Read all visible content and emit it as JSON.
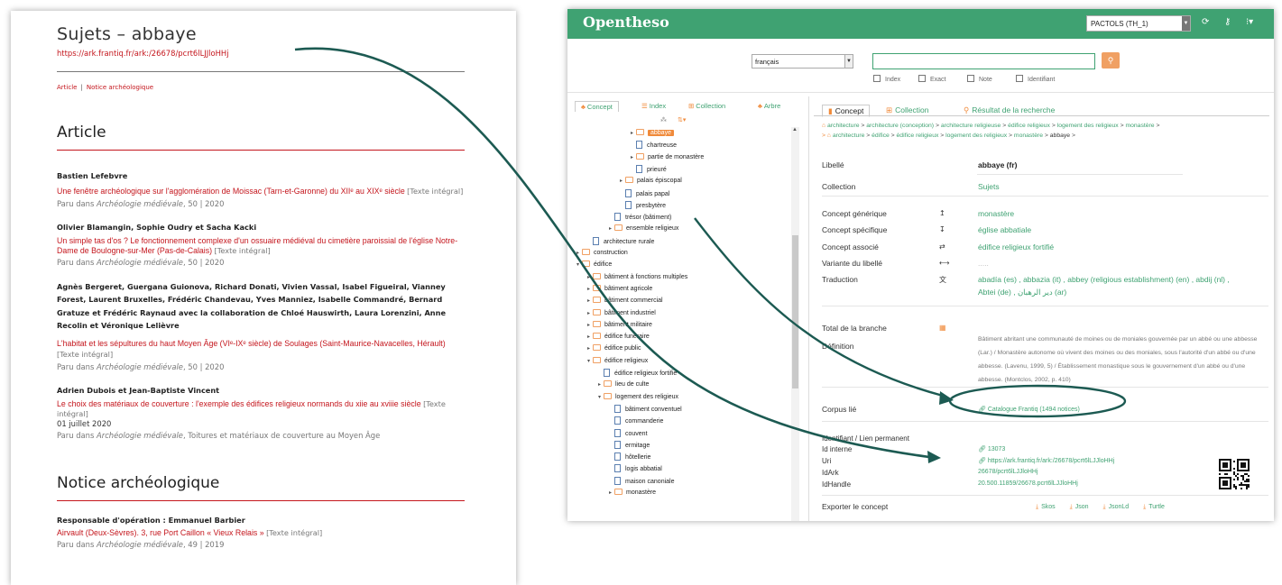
{
  "document": {
    "title": "Sujets – abbaye",
    "url": "https://ark.frantiq.fr/ark:/26678/pcrt6lLJJloHHj",
    "nav": [
      "Article",
      "Notice archéologique"
    ],
    "nav_separator": "|",
    "sections": [
      {
        "heading": "Article",
        "entries": [
          {
            "authors": "Bastien Lefebvre",
            "title": "Une fenêtre archéologique sur l'agglomération de Moissac (Tarn-et-Garonne) du XIIᵉ au XIXᵉ siècle",
            "link_label": "[Texte intégral]",
            "date": "",
            "published_prefix": "Paru dans ",
            "journal": "Archéologie médiévale",
            "published_suffix": ", 50 | 2020"
          },
          {
            "authors": "Olivier Blamangin, Sophie Oudry et Sacha Kacki",
            "title": "Un simple tas d'os ? Le fonctionnement complexe d'un ossuaire médiéval du cimetière paroissial de l'église Notre-Dame de Boulogne-sur-Mer (Pas-de-Calais)",
            "link_label": "[Texte intégral]",
            "date": "",
            "published_prefix": "Paru dans ",
            "journal": "Archéologie médiévale",
            "published_suffix": ", 50 | 2020"
          },
          {
            "authors": "Agnès Bergeret, Guergana Guionova, Richard Donati, Vivien Vassal, Isabel Figueiral, Vianney Forest, Laurent Bruxelles, Frédéric Chandevau, Yves Manniez, Isabelle Commandré, Bernard Gratuze et Frédéric Raynaud avec la collaboration de Chloé Hauswirth, Laura Lorenzini, Anne Recolin et Véronique Lelièvre",
            "title": "L'habitat et les sépultures du haut Moyen Âge (VIᵉ-IXᵉ siècle) de Soulages (Saint-Maurice-Navacelles, Hérault)",
            "link_label": "[Texte intégral]",
            "date": "",
            "published_prefix": "Paru dans ",
            "journal": "Archéologie médiévale",
            "published_suffix": ", 50 | 2020"
          },
          {
            "authors": "Adrien Dubois et Jean-Baptiste Vincent",
            "title": "Le choix des matériaux de couverture : l'exemple des édifices religieux normands du xiie au xviiie siècle",
            "link_label": "[Texte intégral]",
            "date": "01 juillet 2020",
            "published_prefix": "Paru dans ",
            "journal": "Archéologie médiévale",
            "published_suffix": ", Toitures et matériaux de couverture au Moyen Âge"
          }
        ]
      },
      {
        "heading": "Notice archéologique",
        "entries": [
          {
            "authors": "Responsable d'opération : Emmanuel Barbier",
            "title": "Airvault (Deux-Sèvres). 3, rue Port Caillon « Vieux Relais »",
            "link_label": "[Texte intégral]",
            "date": "",
            "published_prefix": "Paru dans ",
            "journal": "Archéologie médiévale",
            "published_suffix": ", 49 | 2019"
          }
        ]
      }
    ]
  },
  "opentheso": {
    "app_name": "Opentheso",
    "thesaurus_select": "PACTOLS (TH_1)",
    "search": {
      "language": "français",
      "query": "",
      "options": [
        "Index",
        "Exact",
        "Note",
        "Identifiant"
      ]
    },
    "left_tabs": [
      "Concept",
      "Index",
      "Collection",
      "Arbre"
    ],
    "tree": [
      {
        "label": "abbaye",
        "type": "folder",
        "level": 5,
        "selected": true
      },
      {
        "label": "chartreuse",
        "type": "leaf",
        "level": 5
      },
      {
        "label": "partie de monastère",
        "type": "folder",
        "level": 5
      },
      {
        "label": "prieuré",
        "type": "leaf",
        "level": 5
      },
      {
        "label": "palais épiscopal",
        "type": "folder",
        "level": 4
      },
      {
        "label": "palais papal",
        "type": "leaf",
        "level": 4
      },
      {
        "label": "presbytère",
        "type": "leaf",
        "level": 4
      },
      {
        "label": "trésor (bâtiment)",
        "type": "leaf",
        "level": 3
      },
      {
        "label": "ensemble religieux",
        "type": "folder",
        "level": 3
      },
      {
        "label": "architecture rurale",
        "type": "leaf",
        "level": 1
      },
      {
        "label": "construction",
        "type": "folder",
        "level": 0
      },
      {
        "label": "édifice",
        "type": "folder",
        "level": 0,
        "open": true
      },
      {
        "label": "bâtiment à fonctions multiples",
        "type": "folder",
        "level": 1
      },
      {
        "label": "bâtiment agricole",
        "type": "folder",
        "level": 1
      },
      {
        "label": "bâtiment commercial",
        "type": "folder",
        "level": 1
      },
      {
        "label": "bâtiment industriel",
        "type": "folder",
        "level": 1
      },
      {
        "label": "bâtiment militaire",
        "type": "folder",
        "level": 1
      },
      {
        "label": "édifice funéraire",
        "type": "folder",
        "level": 1
      },
      {
        "label": "édifice public",
        "type": "folder",
        "level": 1
      },
      {
        "label": "édifice religieux",
        "type": "folder",
        "level": 1,
        "open": true
      },
      {
        "label": "édifice religieux fortifié",
        "type": "leaf",
        "level": 2
      },
      {
        "label": "lieu de culte",
        "type": "folder",
        "level": 2
      },
      {
        "label": "logement des religieux",
        "type": "folder",
        "level": 2,
        "open": true
      },
      {
        "label": "bâtiment conventuel",
        "type": "leaf",
        "level": 3
      },
      {
        "label": "commanderie",
        "type": "leaf",
        "level": 3
      },
      {
        "label": "couvent",
        "type": "leaf",
        "level": 3
      },
      {
        "label": "ermitage",
        "type": "leaf",
        "level": 3
      },
      {
        "label": "hôtellerie",
        "type": "leaf",
        "level": 3
      },
      {
        "label": "logis abbatial",
        "type": "leaf",
        "level": 3
      },
      {
        "label": "maison canoniale",
        "type": "leaf",
        "level": 3
      },
      {
        "label": "monastère",
        "type": "folder",
        "level": 3
      }
    ],
    "right_tabs": [
      "Concept",
      "Collection",
      "Résultat de la recherche"
    ],
    "breadcrumb": {
      "line1": [
        "architecture",
        "architecture (conception)",
        "architecture religieuse",
        "édifice religieux",
        "logement des religieux",
        "monastère"
      ],
      "line2": [
        "architecture",
        "édifice",
        "édifice religieux",
        "logement des religieux",
        "monastère",
        "abbaye"
      ]
    },
    "concept": {
      "label_key": "Libellé",
      "label_value": "abbaye (fr)",
      "collection_key": "Collection",
      "collection_value": "Sujets",
      "broader_key": "Concept générique",
      "broader_value": "monastère",
      "narrower_key": "Concept spécifique",
      "narrower_value": "église abbatiale",
      "related_key": "Concept associé",
      "related_value": "édifice religieux fortifié",
      "variant_key": "Variante du libellé",
      "variant_value": ".....",
      "translation_key": "Traduction",
      "translation_line1": "abadía (es) , abbazia (it) , abbey (religious establishment) (en) , abdij (nl) ,",
      "translation_line2": "Abtei (de) , دير الرهبان (ar)",
      "total_key": "Total de la branche",
      "definition_key": "Définition",
      "definition_text": "Bâtiment abritant une communauté de moines ou de moniales gouvernée par un abbé ou une abbesse (Lar.) / Monastère autonome où vivent des moines ou des moniales, sous l'autorité d'un abbé ou d'une abbesse. (Lavenu, 1999, 5) / Établissement monastique sous le gouvernement d'un abbé ou d'une abbesse. (Montclos, 2002, p. 410)",
      "corpus_key": "Corpus lié",
      "corpus_value": "Catalogue Frantiq (1494 notices)",
      "id_title": "Identifiant / Lien permanent",
      "id_interne_key": "Id interne",
      "id_interne_value": "13073",
      "uri_key": "Uri",
      "uri_value": "https://ark.frantiq.fr/ark:/26678/pcrt6lLJJloHHj",
      "idark_key": "IdArk",
      "idark_value": "26678/pcrt6lLJJloHHj",
      "idhandle_key": "IdHandle",
      "idhandle_value": "20.500.11859/26678.pcrt6lLJJloHHj",
      "export_key": "Exporter le concept",
      "export_formats": [
        "Skos",
        "Json",
        "JsonLd",
        "Turtle"
      ]
    }
  },
  "colors": {
    "brand_green": "#3fa272",
    "accent_orange": "#f08a3a",
    "doc_red": "#c4151c",
    "annotation": "#1c5a52"
  },
  "icons": {
    "broader": "arrow-up-icon",
    "narrower": "arrow-down-icon",
    "related": "equals-icon",
    "variant": "dash-icon",
    "translation": "translate-icon",
    "link": "link-icon",
    "export": "download-icon"
  }
}
